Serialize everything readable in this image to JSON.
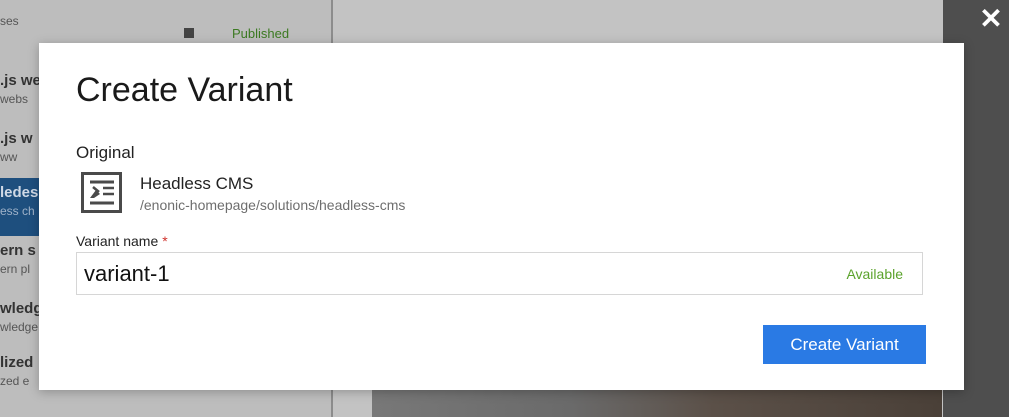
{
  "background": {
    "list_items": [
      {
        "line1": "",
        "line2": "ses"
      },
      {
        "line1": ".js we",
        "line2": "webs"
      },
      {
        "line1": ".js w",
        "line2": "ww"
      },
      {
        "line1": "ledes",
        "line2": "ess ch"
      },
      {
        "line1": "ern s",
        "line2": "ern pl"
      },
      {
        "line1": "wledg",
        "line2": "wledge"
      },
      {
        "line1": "lized",
        "line2": "zed e"
      }
    ],
    "top_status": "Published",
    "colors": {
      "selected_row": "#1e4f7e",
      "status_published": "#3c7a22"
    }
  },
  "dialog": {
    "title": "Create Variant",
    "original_label": "Original",
    "original": {
      "icon": "content-icon",
      "name": "Headless CMS",
      "path": "/enonic-homepage/solutions/headless-cms"
    },
    "variant_name_label": "Variant name",
    "required_marker": "*",
    "variant_name_value": "variant-1",
    "availability_text": "Available",
    "submit_label": "Create Variant",
    "close_icon": "close-icon",
    "close_glyph": "✕",
    "colors": {
      "primary_button": "#2a7ae4",
      "available": "#5ba32c",
      "required": "#d0332d"
    }
  }
}
